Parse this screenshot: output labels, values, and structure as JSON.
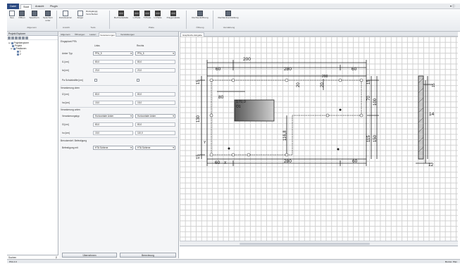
{
  "menu": {
    "file": "Datei",
    "tabs": [
      "Start",
      "Ansicht",
      "PlugIn"
    ],
    "active_tab": "Start",
    "right_glyph": "▾ ⓘ"
  },
  "ribbon": {
    "buttons": [
      {
        "key": "new",
        "label": "Neu"
      },
      {
        "key": "open",
        "label": "Öffnen"
      },
      {
        "key": "save",
        "label": "Speichern"
      },
      {
        "key": "saveas",
        "label": "Speichern unter"
      },
      {
        "key": "undo",
        "label": "Zurücksetzen"
      },
      {
        "key": "pointer",
        "label": "Zeiger"
      },
      {
        "key": "move",
        "label": "Verschieben"
      },
      {
        "key": "extra",
        "label": "Rückgängig"
      },
      {
        "key": "plate",
        "label": "Rechteckplatte"
      },
      {
        "key": "lplate",
        "label": "L-Platte"
      },
      {
        "key": "tplate",
        "label": "T-Platte"
      },
      {
        "key": "uplate",
        "label": "U-Platte"
      },
      {
        "key": "polyplate",
        "label": "Polygonplatte"
      },
      {
        "key": "rectopen",
        "label": "Rechtecköffnung"
      },
      {
        "key": "rectreinf",
        "label": "Rechteckverstärkung"
      }
    ],
    "groups": [
      "Allgemein",
      "Ansicht",
      "Tools",
      "Platte",
      "Öffnung",
      "Verstärkung"
    ]
  },
  "explorer": {
    "title": "Projekt Explorer",
    "tree": [
      "Projektexplorer",
      "Projekt",
      "Positionen",
      "1",
      "2"
    ],
    "search_label": "Suchen"
  },
  "properties": {
    "tabs": [
      "Allgemein",
      "Öffnungen",
      "Lasten",
      "Verankerungen",
      "Verstärkungen"
    ],
    "active_tab": "Verankerungen",
    "sections": {
      "pfa": "Eingeplant PFA",
      "bottom": "Verankerung oben",
      "lower": "Verankerung unten",
      "reinf": "Benutzerdef. Befestigung"
    },
    "col_left": "Links",
    "col_right": "Rechts",
    "rows": {
      "anker_typ": {
        "label": "Anker Typ",
        "left": "PFA_5",
        "right": "PFA_5"
      },
      "l1": {
        "label": "l1 [cm]",
        "left": "80,0",
        "right": "80,0"
      },
      "la": {
        "label": "la [cm]",
        "left": "20,0",
        "right": "20,0"
      },
      "pa": {
        "label": "Pa Schubkräfte [cm]",
        "left": "",
        "right": ""
      },
      "l2": {
        "label": "l2 [cm]",
        "left": "80,0",
        "right": "80,0"
      },
      "ha": {
        "label": "ha [cm]",
        "left": "15,0",
        "right": "15,0"
      },
      "anker_art": {
        "label": "Verankerungstyp",
        "left": "Horizontaler Anker",
        "right": "Horizontaler Anker"
      },
      "l3": {
        "label": "l3 [cm]",
        "left": "80,0",
        "right": "80,0"
      },
      "hu": {
        "label": "hu [cm]",
        "left": "15,0",
        "right": "110,0"
      },
      "befestigung": {
        "label": "Befestigung mit",
        "left": "HTA Schiene",
        "right": "HTA Schiene"
      }
    },
    "buttons": {
      "apply": "Übernehmen",
      "calc": "Berechnung"
    }
  },
  "canvas": {
    "tab": "Graphische Eingabe",
    "dims": {
      "top_outer": "200",
      "top_mid": "280",
      "top_left": "60",
      "top_right": "60",
      "top_left2": "80",
      "inner_left": "20",
      "bot_left": "60",
      "bot_mid": "280",
      "bot_right": "60",
      "right_top1": "15",
      "right_top2": "70",
      "right_top3": "100",
      "right_mid": "115",
      "right_bot": "150",
      "left_top": "15",
      "left_mid": "130",
      "left_bot": "15",
      "inner_h": "116,8",
      "opening_w": "170,0",
      "opening_label": "O1",
      "section_h": "14",
      "section_w": "12",
      "x_marker": "X",
      "y_marker": "Y"
    }
  },
  "status": {
    "left": "PFA 4.0",
    "right": "Modus: Plan"
  }
}
